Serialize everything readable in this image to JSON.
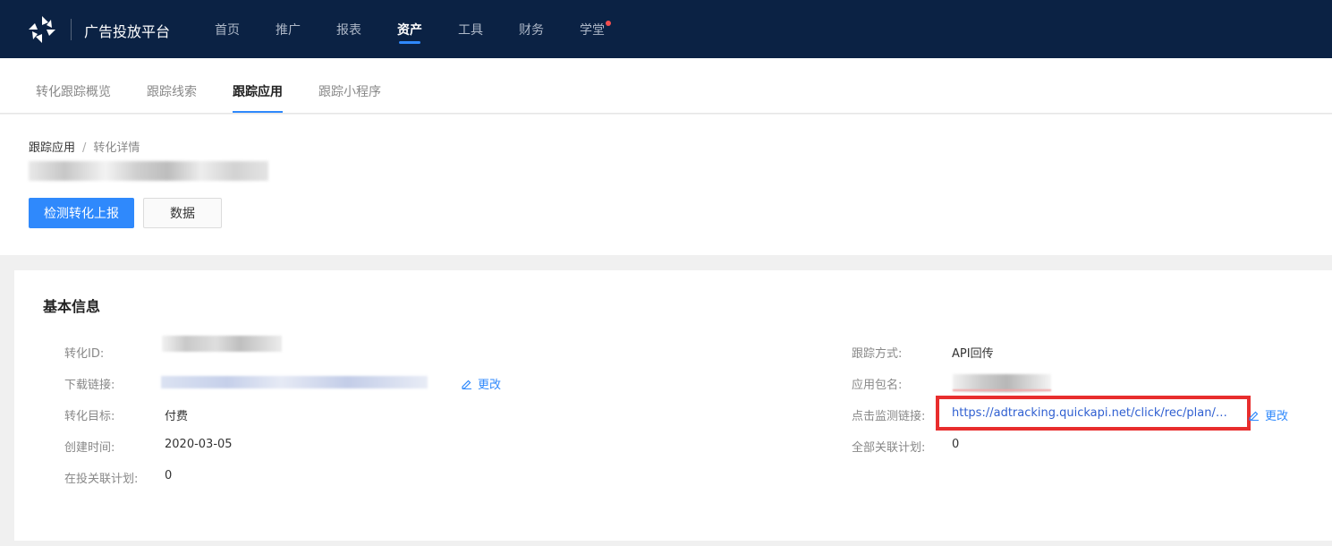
{
  "topbar": {
    "brand": "广告投放平台",
    "nav": [
      {
        "label": "首页"
      },
      {
        "label": "推广"
      },
      {
        "label": "报表"
      },
      {
        "label": "资产"
      },
      {
        "label": "工具"
      },
      {
        "label": "财务"
      },
      {
        "label": "学堂"
      }
    ],
    "active_nav": "资产",
    "accent": "#2f89fc",
    "background": "#0b2244",
    "notification_dot_color": "#f44e4e"
  },
  "subnav": {
    "items": [
      {
        "label": "转化跟踪概览"
      },
      {
        "label": "跟踪线索"
      },
      {
        "label": "跟踪应用"
      },
      {
        "label": "跟踪小程序"
      }
    ],
    "active": "跟踪应用"
  },
  "breadcrumb": {
    "items": [
      "跟踪应用",
      "转化详情"
    ],
    "separator": "/"
  },
  "header": {
    "primary_button": "检测转化上报",
    "secondary_button": "数据"
  },
  "basic_info": {
    "title": "基本信息",
    "left": {
      "conversion_id_label": "转化ID:",
      "download_link_label": "下载链接:",
      "edit_label": "更改",
      "target_label": "转化目标:",
      "target_value": "付费",
      "created_label": "创建时间:",
      "created_value": "2020-03-05",
      "linked_plans_label": "在投关联计划:",
      "linked_plans_value": "0"
    },
    "right": {
      "tracking_method_label": "跟踪方式:",
      "tracking_method_value": "API回传",
      "package_label": "应用包名:",
      "click_link_label": "点击监测链接:",
      "click_link_value": "https://adtracking.quickapi.net/click/rec/plan/Vz...",
      "edit_label": "更改",
      "all_plans_label": "全部关联计划:",
      "all_plans_value": "0"
    }
  }
}
